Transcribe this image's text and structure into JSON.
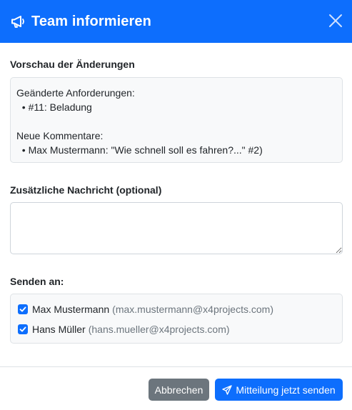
{
  "header": {
    "title": "Team informieren"
  },
  "preview": {
    "label": "Vorschau der Änderungen",
    "changed_heading": "Geänderte Anforderungen:",
    "changed_items": [
      "  • #11: Beladung"
    ],
    "comments_heading": "Neue Kommentare:",
    "comment_items": [
      "  • Max Mustermann: \"Wie schnell soll es fahren?...\" #2)"
    ]
  },
  "message": {
    "label": "Zusätzliche Nachricht (optional)",
    "value": "",
    "placeholder": ""
  },
  "recipients": {
    "label": "Senden an:",
    "items": [
      {
        "name": "Max Mustermann",
        "email": "(max.mustermann@x4projects.com)",
        "checked": true
      },
      {
        "name": "Hans Müller",
        "email": "(hans.mueller@x4projects.com)",
        "checked": true
      }
    ]
  },
  "footer": {
    "cancel_label": "Abbrechen",
    "send_label": "Mitteilung jetzt senden"
  },
  "colors": {
    "primary": "#0d6efd",
    "secondary": "#6c757d",
    "panel_bg": "#f8f9fa",
    "border": "#dee2e6"
  },
  "icons": {
    "header": "megaphone-icon",
    "close": "close-icon",
    "checkbox": "checkmark-icon",
    "send": "paper-plane-icon"
  }
}
